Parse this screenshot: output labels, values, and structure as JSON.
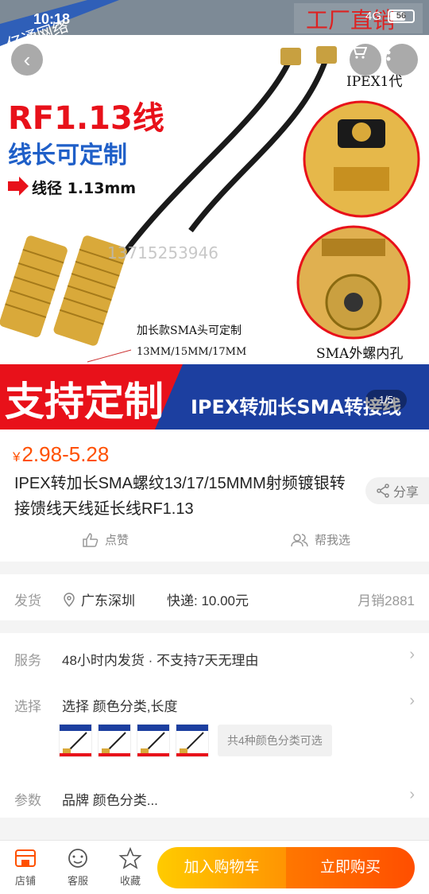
{
  "status_bar": {
    "time": "10:18",
    "signal": "4G",
    "battery": "56"
  },
  "gallery": {
    "watermark_brand": "亿通网络",
    "watermark_store": "工厂直销",
    "headline": "RF1.13线",
    "subheadline": "线长可定制",
    "spec_line": "线径 1.13mm",
    "phone_watermark": "13715253946",
    "connector_label_top": "IPEX1代",
    "connector_label_bottom": "SMA外螺内孔",
    "cable_note_1": "加长款SMA头可定制",
    "cable_note_2": "13MM/15MM/17MM",
    "banner_left": "支持定制",
    "banner_right": "IPEX转加长SMA转接线",
    "page_indicator": "1/5"
  },
  "product": {
    "currency": "¥",
    "price": "2.98-5.28",
    "title": "IPEX转加长SMA螺纹13/17/15MMM射频镀银转接馈线天线延长线RF1.13",
    "share_label": "分享",
    "like_label": "点赞",
    "help_label": "帮我选"
  },
  "shipping": {
    "label": "发货",
    "location": "广东深圳",
    "fee": "快递: 10.00元",
    "monthly_sales": "月销2881"
  },
  "options": {
    "service_label": "服务",
    "service_value": "48小时内发货 · 不支持7天无理由",
    "select_label": "选择",
    "select_value": "选择 颜色分类,长度",
    "more_variants": "共4种颜色分类可选",
    "params_label": "参数",
    "params_value": "品牌 颜色分类..."
  },
  "bottom_bar": {
    "shop_label": "店铺",
    "service_label": "客服",
    "favorite_label": "收藏",
    "add_to_cart": "加入购物车",
    "buy_now": "立即购买"
  },
  "colors": {
    "accent": "#ff5000",
    "cart_start": "#ffcb00",
    "buy_end": "#ff4e00"
  }
}
